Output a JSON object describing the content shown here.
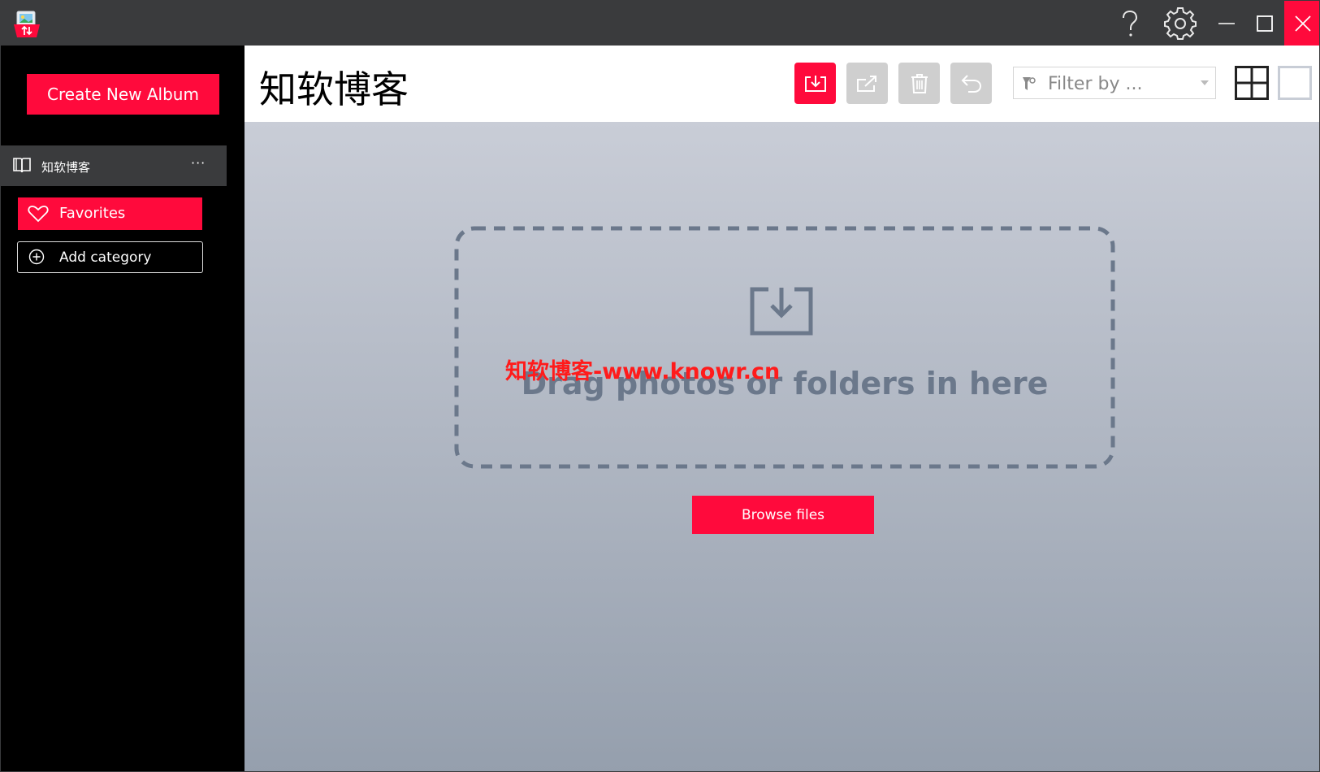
{
  "app": {
    "icon": "photo-album-app-icon"
  },
  "colors": {
    "accent": "#ff0a3c",
    "titlebar": "#3a3b3d",
    "disabled_action": "#cfcfcf",
    "drop_text": "#6b788b",
    "watermark": "#ff1b1b"
  },
  "titlebar": {
    "help_icon": "help-icon",
    "settings_icon": "gear-icon",
    "minimize_icon": "minimize-icon",
    "maximize_icon": "maximize-icon",
    "close_icon": "close-icon"
  },
  "sidebar": {
    "create_album_label": "Create New Album",
    "album": {
      "label": "知软博客",
      "more": "···",
      "icon": "book-icon"
    },
    "favorites": {
      "label": "Favorites",
      "icon": "heart-icon"
    },
    "add_category": {
      "label": "Add category",
      "icon": "plus-circle-icon"
    }
  },
  "header": {
    "title": "知软博客",
    "actions": [
      {
        "name": "import",
        "icon": "import-icon",
        "enabled": true
      },
      {
        "name": "export",
        "icon": "export-icon",
        "enabled": false
      },
      {
        "name": "delete",
        "icon": "trash-icon",
        "enabled": false
      },
      {
        "name": "undo",
        "icon": "undo-icon",
        "enabled": false
      }
    ],
    "filter": {
      "placeholder": "Filter by ...",
      "value": "",
      "icon": "filter-icon"
    },
    "view_modes": [
      {
        "name": "grid",
        "icon": "grid-view-icon"
      },
      {
        "name": "single",
        "icon": "single-view-icon"
      }
    ]
  },
  "main": {
    "drop_text": "Drag photos or folders in here",
    "drop_icon": "import-tray-icon",
    "watermark": "知软博客-www.knowr.cn",
    "browse_label": "Browse files"
  }
}
